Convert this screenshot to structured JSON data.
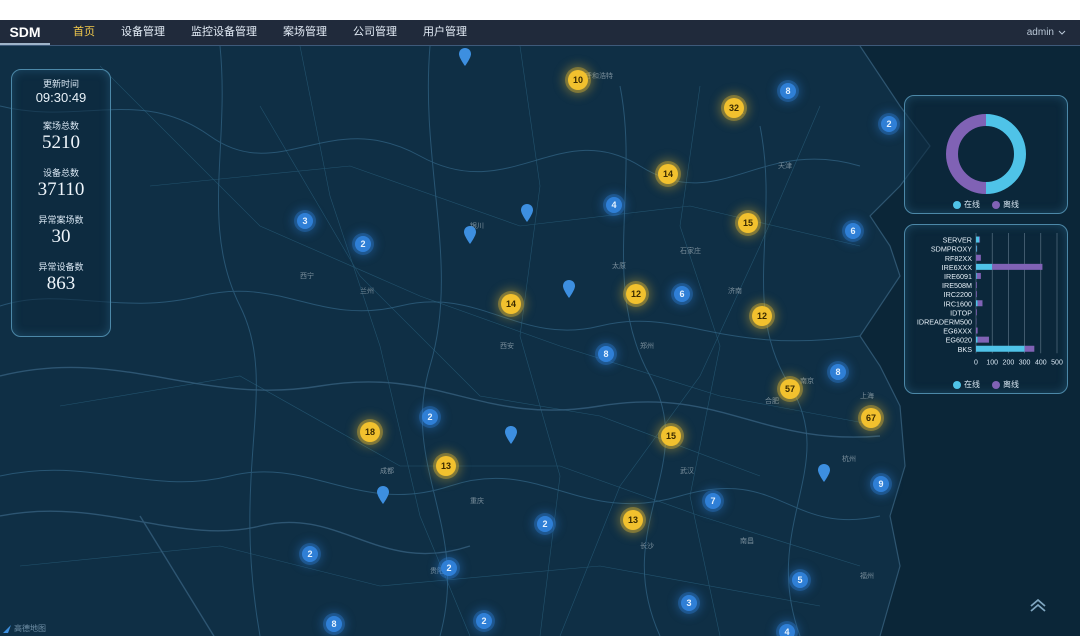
{
  "app": {
    "brand": "SDM",
    "user": "admin"
  },
  "nav": [
    "首页",
    "设备管理",
    "监控设备管理",
    "案场管理",
    "公司管理",
    "用户管理"
  ],
  "stats": {
    "update_time_label": "更新时间",
    "update_time": "09:30:49",
    "sites_label": "案场总数",
    "sites": "5210",
    "devices_label": "设备总数",
    "devices": "37110",
    "abnormal_sites_label": "异常案场数",
    "abnormal_sites": "30",
    "abnormal_devices_label": "异常设备数",
    "abnormal_devices": "863"
  },
  "legend": {
    "online": "在线",
    "offline": "离线"
  },
  "colors": {
    "online": "#4fc3e8",
    "offline": "#8062b5",
    "cluster_hot": "#f2c12e",
    "cluster_normal": "#2f7fd6",
    "map_bg": "#0f2f45"
  },
  "map": {
    "clusters": [
      {
        "label": "10",
        "tone": "yellow"
      },
      {
        "label": "32",
        "tone": "yellow"
      },
      {
        "label": "8",
        "tone": "blue"
      },
      {
        "label": "2",
        "tone": "blue"
      },
      {
        "label": "14",
        "tone": "yellow"
      },
      {
        "label": "3",
        "tone": "blue"
      },
      {
        "label": "2",
        "tone": "blue"
      },
      {
        "label": "4",
        "tone": "blue"
      },
      {
        "label": "15",
        "tone": "yellow"
      },
      {
        "label": "6",
        "tone": "blue"
      },
      {
        "label": "14",
        "tone": "yellow"
      },
      {
        "label": "12",
        "tone": "yellow"
      },
      {
        "label": "6",
        "tone": "blue"
      },
      {
        "label": "12",
        "tone": "yellow"
      },
      {
        "label": "8",
        "tone": "blue"
      },
      {
        "label": "57",
        "tone": "yellow"
      },
      {
        "label": "8",
        "tone": "blue"
      },
      {
        "label": "2",
        "tone": "blue"
      },
      {
        "label": "18",
        "tone": "yellow"
      },
      {
        "label": "15",
        "tone": "yellow"
      },
      {
        "label": "67",
        "tone": "yellow"
      },
      {
        "label": "13",
        "tone": "yellow"
      },
      {
        "label": "9",
        "tone": "blue"
      },
      {
        "label": "7",
        "tone": "blue"
      },
      {
        "label": "2",
        "tone": "blue"
      },
      {
        "label": "13",
        "tone": "yellow"
      },
      {
        "label": "2",
        "tone": "blue"
      },
      {
        "label": "2",
        "tone": "blue"
      },
      {
        "label": "5",
        "tone": "blue"
      },
      {
        "label": "3",
        "tone": "blue"
      },
      {
        "label": "8",
        "tone": "blue"
      },
      {
        "label": "2",
        "tone": "blue"
      },
      {
        "label": "4",
        "tone": "blue"
      }
    ],
    "cities": [
      "呼和浩特",
      "北京",
      "天津",
      "石家庄",
      "太原",
      "济南",
      "郑州",
      "西安",
      "银川",
      "兰州",
      "西宁",
      "合肥",
      "南京",
      "上海",
      "杭州",
      "武汉",
      "长沙",
      "南昌",
      "成都",
      "重庆",
      "福州",
      "贵阳"
    ],
    "map_logo": "高德地图"
  },
  "chart_data": [
    {
      "type": "pie",
      "variant": "donut",
      "labels": [
        "在线",
        "离线"
      ],
      "values": [
        50,
        50
      ],
      "legend_position": "bottom"
    },
    {
      "type": "bar",
      "orientation": "horizontal",
      "stacked": true,
      "categories": [
        "SERVER",
        "SDMPROXY",
        "RF82XX",
        "IRE6XXX",
        "IRE6091",
        "IRE508M",
        "IRC2200",
        "IRC1600",
        "IDTOP",
        "IDREADERM500",
        "EG6XXX",
        "EG6020",
        "BKS"
      ],
      "series": [
        {
          "name": "在线",
          "values": [
            20,
            5,
            0,
            100,
            5,
            0,
            0,
            10,
            0,
            0,
            0,
            10,
            300
          ]
        },
        {
          "name": "离线",
          "values": [
            5,
            2,
            30,
            310,
            25,
            5,
            5,
            30,
            5,
            2,
            10,
            70,
            60
          ]
        }
      ],
      "xlim": [
        0,
        500
      ],
      "xticks": [
        0,
        100,
        200,
        300,
        400,
        500
      ],
      "legend_position": "bottom",
      "grid": true
    }
  ]
}
